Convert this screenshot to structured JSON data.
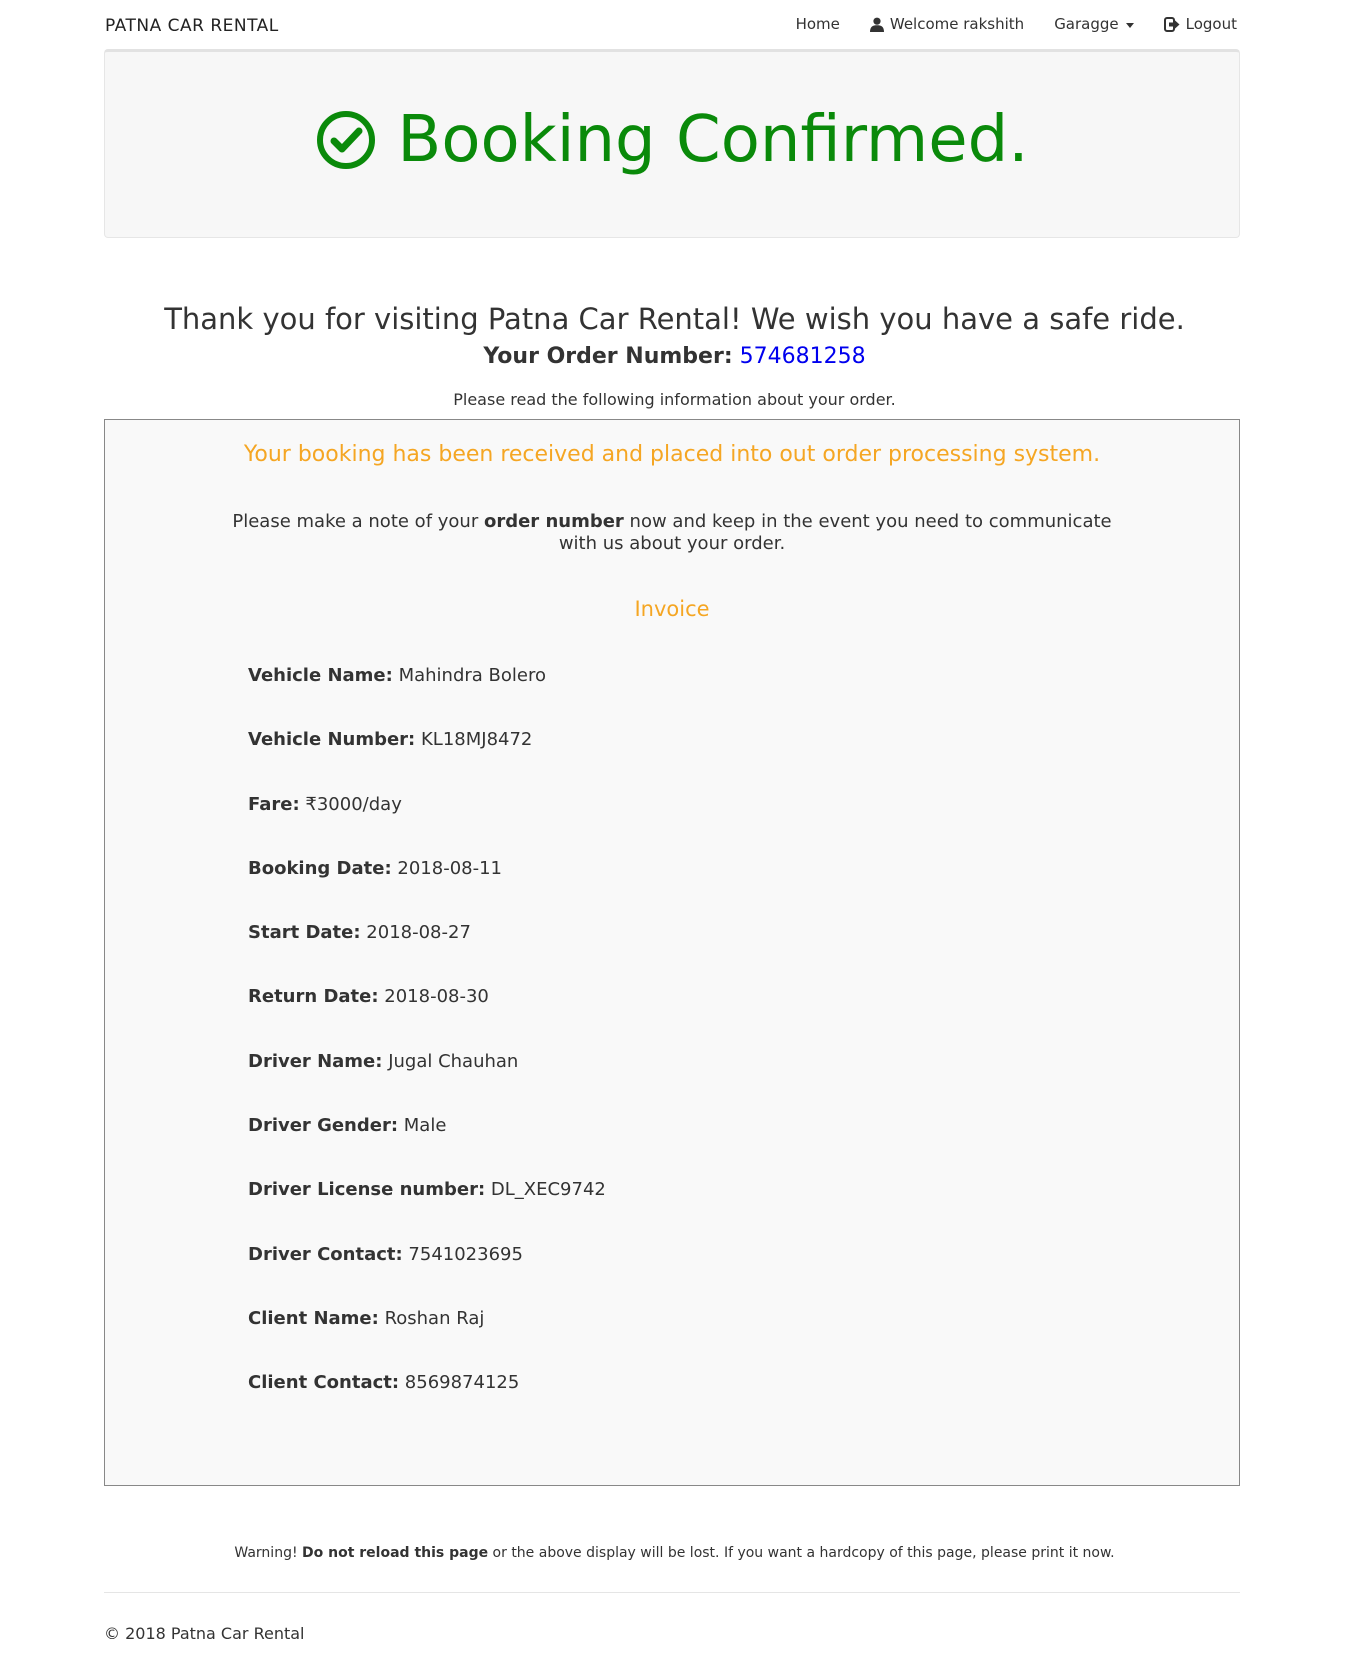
{
  "navbar": {
    "brand": "PATNA CAR RENTAL",
    "home": "Home",
    "welcome": "Welcome rakshith",
    "garage": "Garagge",
    "logout": "Logout"
  },
  "jumbotron": {
    "title": "Booking Confirmed.",
    "icon": "check-circle-icon",
    "color": "#0a8a0a"
  },
  "thanks": "Thank you for visiting Patna Car Rental! We wish you have a safe ride.",
  "order": {
    "label": "Your Order Number:",
    "number": "574681258"
  },
  "read_info": "Please read the following information about your order.",
  "box": {
    "received": "Your booking has been received and placed into out order processing system.",
    "note_pre": "Please make a note of your",
    "note_bold": "order number",
    "note_post": "now and keep in the event you need to communicate",
    "note_line2": "with us about your order.",
    "invoice_title": "Invoice",
    "invoice": [
      {
        "label": "Vehicle Name:",
        "value": "Mahindra Bolero"
      },
      {
        "label": "Vehicle Number:",
        "value": "KL18MJ8472"
      },
      {
        "label": "Fare:",
        "value": "₹3000/day"
      },
      {
        "label": "Booking Date:",
        "value": "2018-08-11"
      },
      {
        "label": "Start Date:",
        "value": "2018-08-27"
      },
      {
        "label": "Return Date:",
        "value": "2018-08-30"
      },
      {
        "label": "Driver Name:",
        "value": "Jugal Chauhan"
      },
      {
        "label": "Driver Gender:",
        "value": "Male"
      },
      {
        "label": "Driver License number:",
        "value": "DL_XEC9742"
      },
      {
        "label": "Driver Contact:",
        "value": "7541023695"
      },
      {
        "label": "Client Name:",
        "value": "Roshan Raj"
      },
      {
        "label": "Client Contact:",
        "value": "8569874125"
      }
    ]
  },
  "warning": {
    "pre": "Warning!",
    "bold": "Do not reload this page",
    "post": "or the above display will be lost. If you want a hardcopy of this page, please print it now."
  },
  "footer": "© 2018 Patna Car Rental",
  "colors": {
    "accent_orange": "#f5a623",
    "order_link": "#0000ee"
  }
}
